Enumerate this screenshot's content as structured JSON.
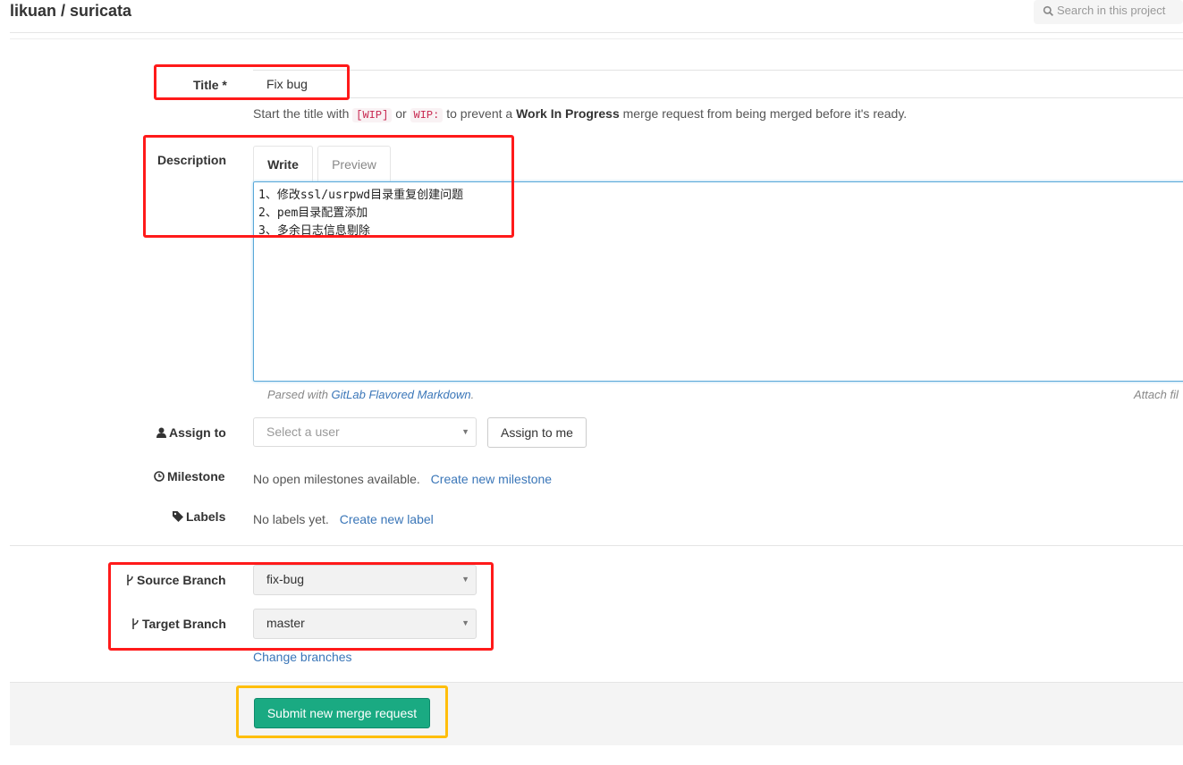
{
  "header": {
    "project_path": "likuan / suricata",
    "search_placeholder": "Search in this project",
    "search_icon": "search-icon"
  },
  "form": {
    "title": {
      "label": "Title *",
      "value": "Fix bug",
      "hint_before": "Start the title with",
      "hint_wip1": "[WIP]",
      "hint_or": "or",
      "hint_wip2": "WIP:",
      "hint_mid": "to prevent a",
      "hint_bold": "Work In Progress",
      "hint_after": "merge request from being merged before it's ready."
    },
    "description": {
      "label": "Description",
      "tabs": [
        "Write",
        "Preview"
      ],
      "active_tab": "Write",
      "lines": [
        "1、修改ssl/usrpwd目录重复创建问题",
        "2、pem目录配置添加",
        "3、多余日志信息剔除"
      ],
      "markdown_prefix": "Parsed with",
      "markdown_link": "GitLab Flavored Markdown",
      "markdown_suffix": ".",
      "attach_text": "Attach fil"
    },
    "assign": {
      "label": "Assign to",
      "icon": "user-icon",
      "placeholder": "Select a user",
      "assign_me_button": "Assign to me"
    },
    "milestone": {
      "label": "Milestone",
      "icon": "clock-icon",
      "text": "No open milestones available.",
      "link": "Create new milestone"
    },
    "labels": {
      "label": "Labels",
      "icon": "tag-icon",
      "text": "No labels yet.",
      "link": "Create new label"
    },
    "branches": {
      "source_label": "Source Branch",
      "source_value": "fix-bug",
      "target_label": "Target Branch",
      "target_value": "master",
      "icon": "branch-icon",
      "change_link": "Change branches"
    },
    "submit_button": "Submit new merge request"
  },
  "colors": {
    "annotation_red": "#ff1a1a",
    "annotation_yellow": "#ffbe0b",
    "submit_green": "#1aaa82",
    "link_blue": "#3a76b8"
  }
}
